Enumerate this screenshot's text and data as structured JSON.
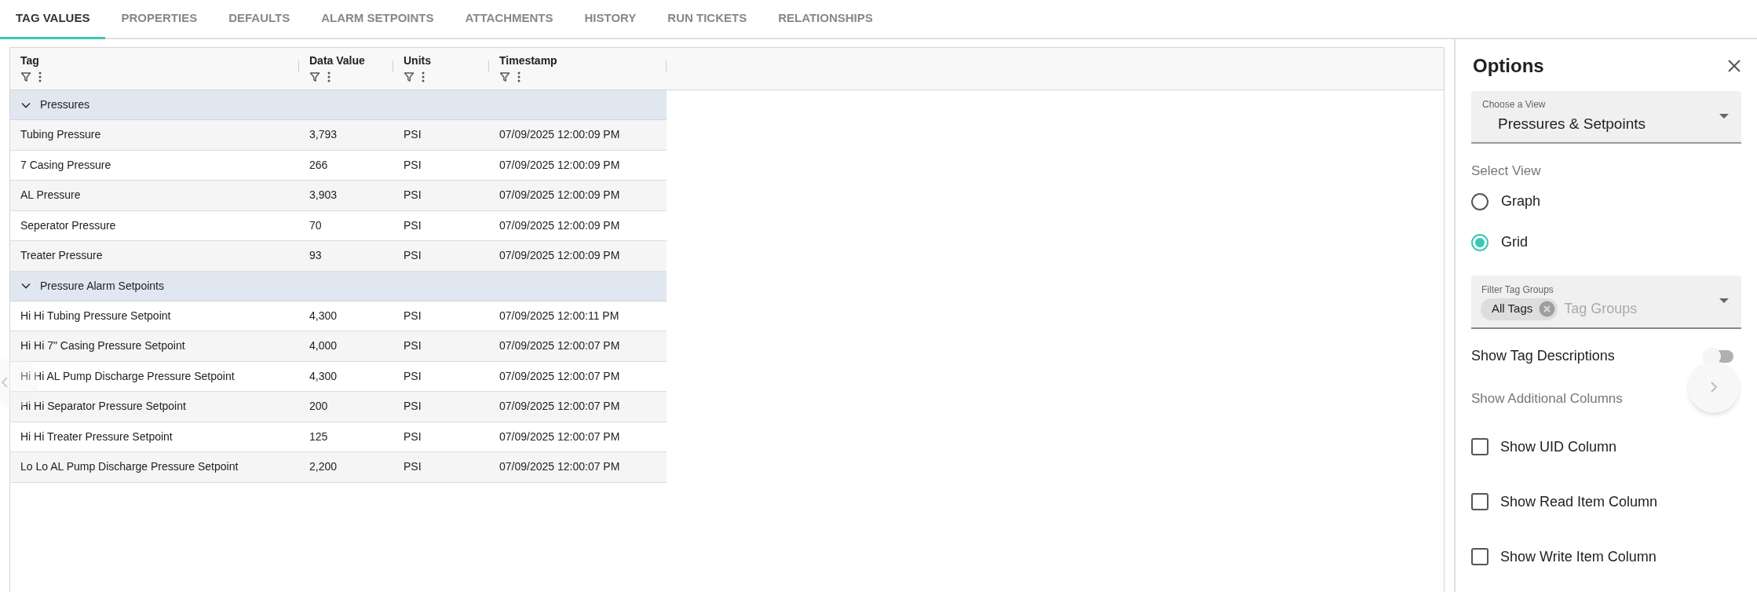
{
  "tabs": [
    {
      "label": "TAG VALUES",
      "selected": true
    },
    {
      "label": "PROPERTIES",
      "selected": false
    },
    {
      "label": "DEFAULTS",
      "selected": false
    },
    {
      "label": "ALARM SETPOINTS",
      "selected": false
    },
    {
      "label": "ATTACHMENTS",
      "selected": false
    },
    {
      "label": "HISTORY",
      "selected": false
    },
    {
      "label": "RUN TICKETS",
      "selected": false
    },
    {
      "label": "RELATIONSHIPS",
      "selected": false
    }
  ],
  "table": {
    "columns": [
      "Tag",
      "Data Value",
      "Units",
      "Timestamp"
    ],
    "groups": [
      {
        "name": "Pressures",
        "expanded": true,
        "rows": [
          [
            "Tubing Pressure",
            "3,793",
            "PSI",
            "07/09/2025 12:00:09 PM"
          ],
          [
            "7 Casing Pressure",
            "266",
            "PSI",
            "07/09/2025 12:00:09 PM"
          ],
          [
            "AL Pressure",
            "3,903",
            "PSI",
            "07/09/2025 12:00:09 PM"
          ],
          [
            "Seperator Pressure",
            "70",
            "PSI",
            "07/09/2025 12:00:09 PM"
          ],
          [
            "Treater Pressure",
            "93",
            "PSI",
            "07/09/2025 12:00:09 PM"
          ]
        ]
      },
      {
        "name": "Pressure Alarm Setpoints",
        "expanded": true,
        "rows": [
          [
            "Hi Hi Tubing Pressure Setpoint",
            "4,300",
            "PSI",
            "07/09/2025 12:00:11 PM"
          ],
          [
            "Hi Hi 7\" Casing Pressure Setpoint",
            "4,000",
            "PSI",
            "07/09/2025 12:00:07 PM"
          ],
          [
            "Hi Hi AL Pump Discharge Pressure Setpoint",
            "4,300",
            "PSI",
            "07/09/2025 12:00:07 PM"
          ],
          [
            "Hi Hi Separator Pressure Setpoint",
            "200",
            "PSI",
            "07/09/2025 12:00:07 PM"
          ],
          [
            "Hi Hi Treater Pressure Setpoint",
            "125",
            "PSI",
            "07/09/2025 12:00:07 PM"
          ],
          [
            "Lo Lo AL Pump Discharge Pressure Setpoint",
            "2,200",
            "PSI",
            "07/09/2025 12:00:07 PM"
          ]
        ]
      }
    ]
  },
  "options": {
    "title": "Options",
    "view_select": {
      "label": "Choose a View",
      "value": "Pressures & Setpoints"
    },
    "select_view": {
      "label": "Select View",
      "options": [
        {
          "label": "Graph",
          "selected": false
        },
        {
          "label": "Grid",
          "selected": true
        }
      ]
    },
    "filter": {
      "label": "Filter Tag Groups",
      "chips": [
        "All Tags"
      ],
      "placeholder": "Tag Groups"
    },
    "tag_descriptions": {
      "label": "Show Tag Descriptions",
      "on": false
    },
    "additional_columns": {
      "label": "Show Additional Columns",
      "checkboxes": [
        {
          "label": "Show UID Column",
          "checked": false
        },
        {
          "label": "Show Read Item Column",
          "checked": false
        },
        {
          "label": "Show Write Item Column",
          "checked": false
        }
      ]
    }
  }
}
